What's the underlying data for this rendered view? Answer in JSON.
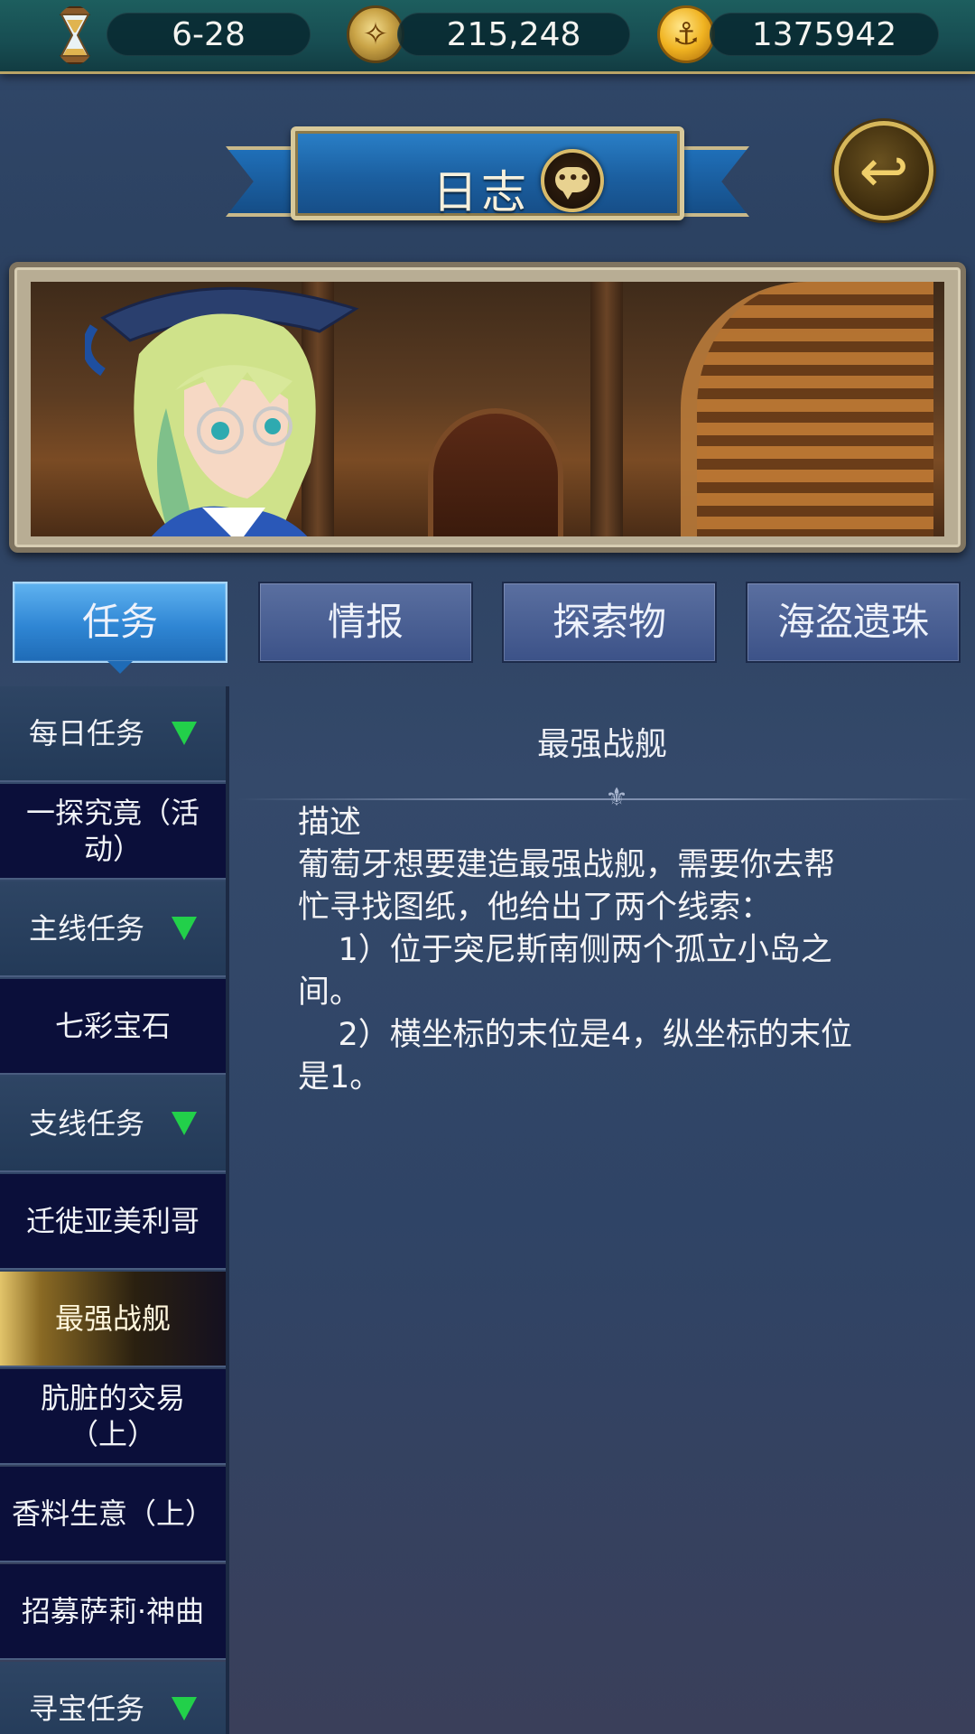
{
  "topbar": {
    "date": {
      "icon": "hourglass-icon",
      "value": "6-28"
    },
    "exploration": {
      "icon": "compass-icon",
      "value": "215,248"
    },
    "gold": {
      "icon": "anchor-coin-icon",
      "value": "1375942"
    }
  },
  "header": {
    "title": "日志",
    "chat_icon": "chat-bubble-icon",
    "back_icon": "back-arrow-icon"
  },
  "tabs": [
    {
      "label": "任务",
      "active": true
    },
    {
      "label": "情报",
      "active": false
    },
    {
      "label": "探索物",
      "active": false
    },
    {
      "label": "海盗遗珠",
      "active": false
    }
  ],
  "quest_list": [
    {
      "label": "每日任务",
      "type": "category",
      "expanded": true
    },
    {
      "label": "一探究竟（活动）",
      "type": "quest"
    },
    {
      "label": "主线任务",
      "type": "category",
      "expanded": true
    },
    {
      "label": "七彩宝石",
      "type": "quest"
    },
    {
      "label": "支线任务",
      "type": "category",
      "expanded": true
    },
    {
      "label": "迁徙亚美利哥",
      "type": "quest"
    },
    {
      "label": "最强战舰",
      "type": "quest",
      "selected": true
    },
    {
      "label": "肮脏的交易（上）",
      "type": "quest"
    },
    {
      "label": "香料生意（上）",
      "type": "quest"
    },
    {
      "label": "招募萨莉·神曲",
      "type": "quest"
    },
    {
      "label": "寻宝任务",
      "type": "category",
      "expanded": true
    }
  ],
  "detail": {
    "title": "最强战舰",
    "section_label": "描述",
    "description_lines": [
      "葡萄牙想要建造最强战舰，需要你去帮",
      "忙寻找图纸，他给出了两个线索：",
      "    1）位于突尼斯南侧两个孤立小岛之",
      "间。",
      "    2）横坐标的末位是4，纵坐标的末位",
      "是1。"
    ]
  },
  "colors": {
    "active_tab": "#2f86d4",
    "tab": "#3c5288",
    "expand_arrow": "#22d04a",
    "selected_highlight": "#e2c46a"
  }
}
